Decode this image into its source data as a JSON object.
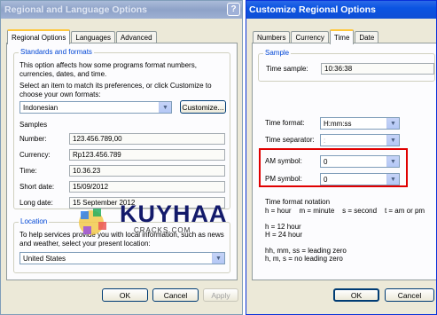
{
  "regional_window": {
    "title": "Regional and Language Options",
    "help_button": "?",
    "tabs": [
      "Regional Options",
      "Languages",
      "Advanced"
    ],
    "standards_group_label": "Standards and formats",
    "standards_desc": "This option affects how some programs format numbers, currencies, dates, and time.",
    "match_desc": "Select an item to match its preferences, or click Customize to choose your own formats:",
    "format_selected": "Indonesian",
    "customize_label": "Customize...",
    "samples_label": "Samples",
    "samples": [
      {
        "label": "Number:",
        "value": "123.456.789,00"
      },
      {
        "label": "Currency:",
        "value": "Rp123.456.789"
      },
      {
        "label": "Time:",
        "value": "10.36.23"
      },
      {
        "label": "Short date:",
        "value": "15/09/2012"
      },
      {
        "label": "Long date:",
        "value": "15 September 2012"
      }
    ],
    "location_group_label": "Location",
    "location_desc": "To help services provide you with local information, such as news and weather, select your present location:",
    "location_selected": "United States",
    "ok_label": "OK",
    "cancel_label": "Cancel",
    "apply_label": "Apply"
  },
  "customize_window": {
    "title": "Customize Regional Options",
    "tabs": [
      "Numbers",
      "Currency",
      "Time",
      "Date"
    ],
    "sample_group_label": "Sample",
    "time_sample_label": "Time sample:",
    "time_sample_value": "10:36:38",
    "time_format_label": "Time format:",
    "time_format_value": "H:mm:ss",
    "time_separator_label": "Time separator:",
    "time_separator_value": ":",
    "am_symbol_label": "AM symbol:",
    "am_symbol_value": "0",
    "pm_symbol_label": "PM symbol:",
    "pm_symbol_value": "0",
    "notation_title": "Time format notation",
    "notation_line1": "h = hour    m = minute    s = second    t = am or pm",
    "notation_line2": "h = 12 hour",
    "notation_line3": "H = 24 hour",
    "notation_line4": "hh, mm, ss = leading zero",
    "notation_line5": "h, m, s = no leading zero",
    "ok_label": "OK",
    "cancel_label": "Cancel"
  },
  "watermark": {
    "main": "KUYHAA",
    "sub": "CRACKS.COM"
  },
  "colors": {
    "highlight_box": "#e00000",
    "group_label": "#0046d5"
  }
}
